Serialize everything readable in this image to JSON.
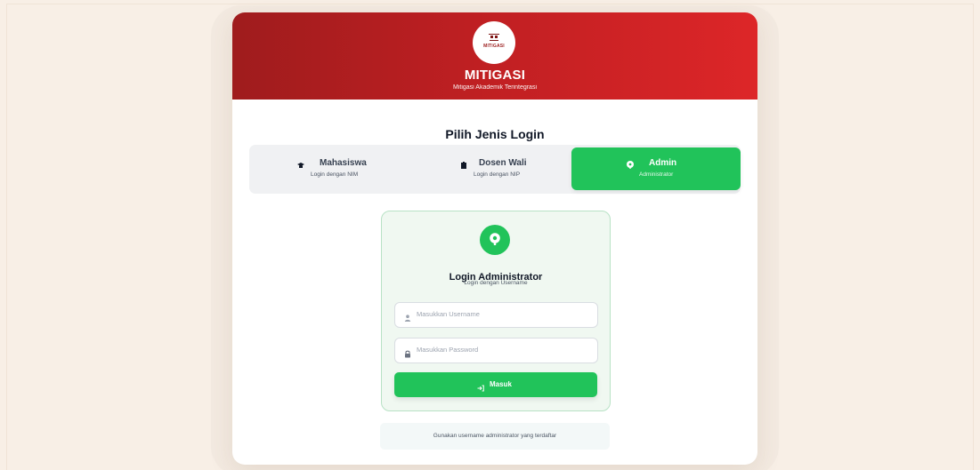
{
  "app": {
    "logo_text": "MITIGASI",
    "brand": "MITIGASI",
    "tagline": "Mitigasi Akademik Terintegrasi"
  },
  "login_choice": {
    "title": "Pilih Jenis Login",
    "tabs": [
      {
        "label": "Mahasiswa",
        "subtitle": "Login dengan NIM",
        "icon": "student-icon",
        "selected": false
      },
      {
        "label": "Dosen Wali",
        "subtitle": "Login dengan NIP",
        "icon": "briefcase-icon",
        "selected": false
      },
      {
        "label": "Admin",
        "subtitle": "Administrator",
        "icon": "admin-icon",
        "selected": true
      }
    ]
  },
  "login_form": {
    "title": "Login Administrator",
    "subtitle": "Login dengan Username",
    "username": {
      "value": "",
      "placeholder": "Masukkan Username",
      "icon": "user-icon"
    },
    "password": {
      "value": "",
      "placeholder": "Masukkan Password",
      "icon": "lock-icon"
    },
    "submit_label": "Masuk",
    "submit_icon": "login-arrow-icon"
  },
  "hint": "Gunakan username administrator yang terdaftar",
  "colors": {
    "page_background": "#f8efe6",
    "header_start": "#9f1c1d",
    "header_end": "#dd2628",
    "primary_green": "#21c35a",
    "panel_background": "#f0f8f1",
    "panel_border": "#b8e2c5",
    "segment_background": "#f0f1f3"
  }
}
